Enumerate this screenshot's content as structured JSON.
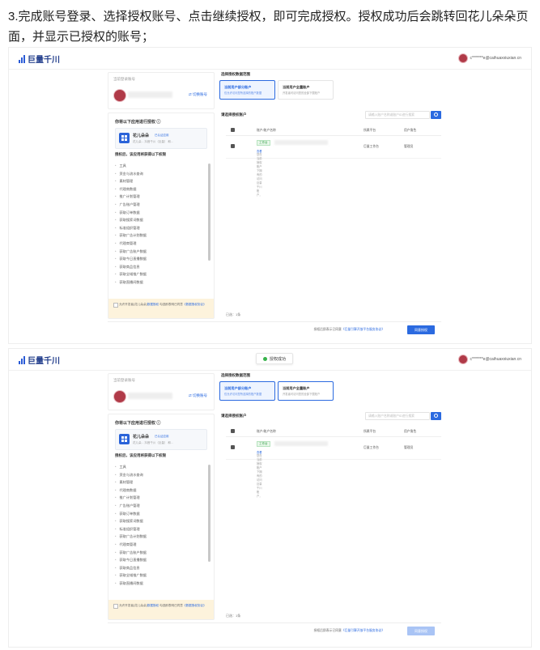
{
  "caption": "3.完成账号登录、选择授权账号、点击继续授权，即可完成授权。授权成功后会跳转回花儿朵朵页面，并显示已授权的账号；",
  "app": {
    "logo_text": "巨量千川",
    "user_email": "c*******e@caihuaxxiuxian.cn",
    "brand_color": "#2b6ae0"
  },
  "toast": {
    "text": "授权成功"
  },
  "account": {
    "label": "当前登录账号",
    "switch_label": "⇄ 切换账号"
  },
  "permissions": {
    "title": "你将以下应用进行授权 ⓘ",
    "app_name": "花儿朵朵",
    "app_tag": "已认证应用",
    "app_desc": "花儿朵... 抖音千川（巨量） 和...",
    "subtitle": "授权后，该应用将获得以下权限",
    "items": [
      "工具",
      "资金与流水查询",
      "素材管理",
      "代理商数据",
      "推广计划管理",
      "广告账户管理",
      "获取订单数据",
      "获取搜索词数据",
      "标准组织管理",
      "获取广告计划数据",
      "代理商管理",
      "获取广告账户数据",
      "获取今日直播数据",
      "获取商品信息",
      "获取全域推广数据",
      "获取直播间数据"
    ],
    "agree_text_1": "允许开发者(花儿朵朵)",
    "agree_link_1": "数据授权",
    "agree_text_2": "勾选即表明已同意",
    "agree_link_2": "《数据授权协议》"
  },
  "scope": {
    "title": "选择授权数据范围",
    "options": [
      {
        "title": "当前用户部分账户",
        "desc": "仅允许访问您所选择的账户数据"
      },
      {
        "title": "当前用户全量账户",
        "desc": "开发者可访问您的全部下属账户"
      }
    ]
  },
  "select": {
    "title": "请选择授权账户",
    "search_placeholder": "请输入账户名称或账户ID进行搜索",
    "columns": [
      "账户/账户名称",
      "所属平台",
      "用户角色"
    ],
    "rows": [
      {
        "tag": "工作台",
        "desc": "您在当前授权账户下拥有的访问巨量千川账户，",
        "desc_link": "查看",
        "platform": "巨量工作台",
        "role": "管理员"
      }
    ],
    "count_text": "已选：1条"
  },
  "footer": {
    "text": "授权后即表示已同意",
    "link": "《巨量引擎开放平台服务协议》",
    "button": "同意授权"
  }
}
